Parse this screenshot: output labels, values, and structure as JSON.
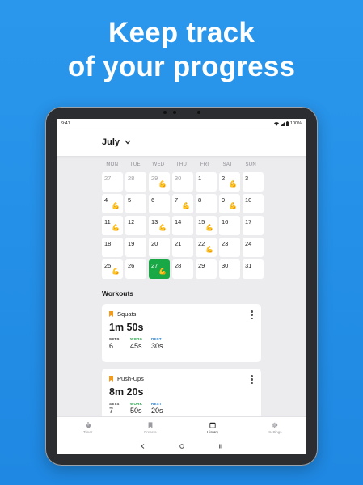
{
  "headline": {
    "line1": "Keep track",
    "line2": "of your progress"
  },
  "status": {
    "time": "9:41",
    "battery": "100%"
  },
  "calendar": {
    "month": "July",
    "weekdays": [
      "MON",
      "TUE",
      "WED",
      "THU",
      "FRI",
      "SAT",
      "SUN"
    ],
    "days": [
      {
        "n": "27",
        "out": true,
        "flex": false
      },
      {
        "n": "28",
        "out": true,
        "flex": false
      },
      {
        "n": "29",
        "out": true,
        "flex": true
      },
      {
        "n": "30",
        "out": true,
        "flex": false
      },
      {
        "n": "1",
        "out": false,
        "flex": false
      },
      {
        "n": "2",
        "out": false,
        "flex": true
      },
      {
        "n": "3",
        "out": false,
        "flex": false
      },
      {
        "n": "4",
        "out": false,
        "flex": true
      },
      {
        "n": "5",
        "out": false,
        "flex": false
      },
      {
        "n": "6",
        "out": false,
        "flex": false
      },
      {
        "n": "7",
        "out": false,
        "flex": true
      },
      {
        "n": "8",
        "out": false,
        "flex": false
      },
      {
        "n": "9",
        "out": false,
        "flex": true
      },
      {
        "n": "10",
        "out": false,
        "flex": false
      },
      {
        "n": "11",
        "out": false,
        "flex": true
      },
      {
        "n": "12",
        "out": false,
        "flex": false
      },
      {
        "n": "13",
        "out": false,
        "flex": true
      },
      {
        "n": "14",
        "out": false,
        "flex": false
      },
      {
        "n": "15",
        "out": false,
        "flex": true
      },
      {
        "n": "16",
        "out": false,
        "flex": false
      },
      {
        "n": "17",
        "out": false,
        "flex": false
      },
      {
        "n": "18",
        "out": false,
        "flex": false
      },
      {
        "n": "19",
        "out": false,
        "flex": false
      },
      {
        "n": "20",
        "out": false,
        "flex": false
      },
      {
        "n": "21",
        "out": false,
        "flex": false
      },
      {
        "n": "22",
        "out": false,
        "flex": true
      },
      {
        "n": "23",
        "out": false,
        "flex": false
      },
      {
        "n": "24",
        "out": false,
        "flex": false
      },
      {
        "n": "25",
        "out": false,
        "flex": true
      },
      {
        "n": "26",
        "out": false,
        "flex": false
      },
      {
        "n": "27",
        "out": false,
        "flex": true,
        "today": true
      },
      {
        "n": "28",
        "out": false,
        "flex": false
      },
      {
        "n": "29",
        "out": false,
        "flex": false
      },
      {
        "n": "30",
        "out": false,
        "flex": false
      },
      {
        "n": "31",
        "out": false,
        "flex": false
      }
    ],
    "flex_glyph": "💪"
  },
  "workouts": {
    "title": "Workouts",
    "items": [
      {
        "name": "Squats",
        "total": "1m 50s",
        "sets_label": "SETS",
        "sets": "6",
        "work_label": "WORK",
        "work": "45s",
        "rest_label": "REST",
        "rest": "30s"
      },
      {
        "name": "Push-Ups",
        "total": "8m 20s",
        "sets_label": "SETS",
        "sets": "7",
        "work_label": "WORK",
        "work": "50s",
        "rest_label": "REST",
        "rest": "20s"
      }
    ]
  },
  "nav": {
    "items": [
      {
        "label": "Timer",
        "icon": "timer-icon"
      },
      {
        "label": "Presets",
        "icon": "bookmark-icon"
      },
      {
        "label": "History",
        "icon": "calendar-icon",
        "active": true
      },
      {
        "label": "Settings",
        "icon": "gear-icon"
      }
    ]
  },
  "colors": {
    "background": "#2a97ec",
    "today": "#19a846",
    "accent_orange": "#f59b1c",
    "work": "#1c9c3e",
    "rest": "#1f7fd8"
  }
}
